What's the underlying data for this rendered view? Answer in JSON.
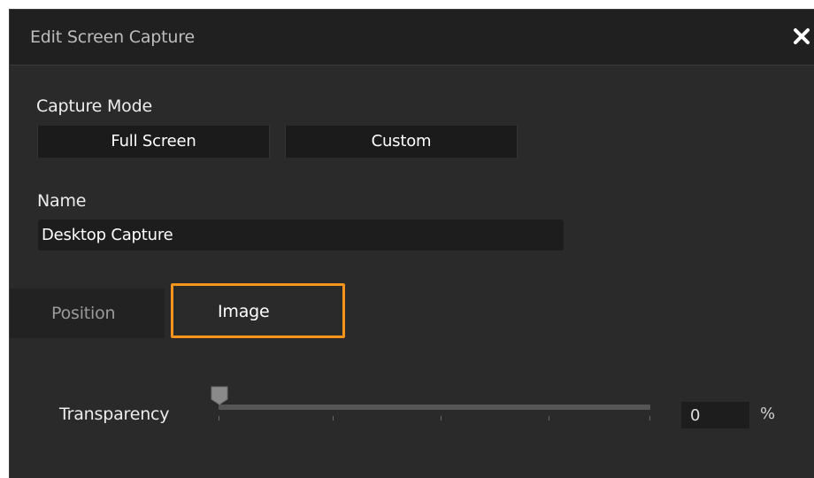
{
  "dialog": {
    "title": "Edit Screen Capture",
    "close_icon": "close-icon"
  },
  "capture_mode": {
    "label": "Capture Mode",
    "options": [
      "Full Screen",
      "Custom"
    ]
  },
  "name": {
    "label": "Name",
    "value": "Desktop Capture"
  },
  "tabs": [
    {
      "label": "Position",
      "selected": false
    },
    {
      "label": "Image",
      "selected": true
    }
  ],
  "transparency": {
    "label": "Transparency",
    "value": "0",
    "unit": "%"
  },
  "colors": {
    "background": "#2a2a2a",
    "titlebar": "#202020",
    "highlight": "#f7941d"
  }
}
